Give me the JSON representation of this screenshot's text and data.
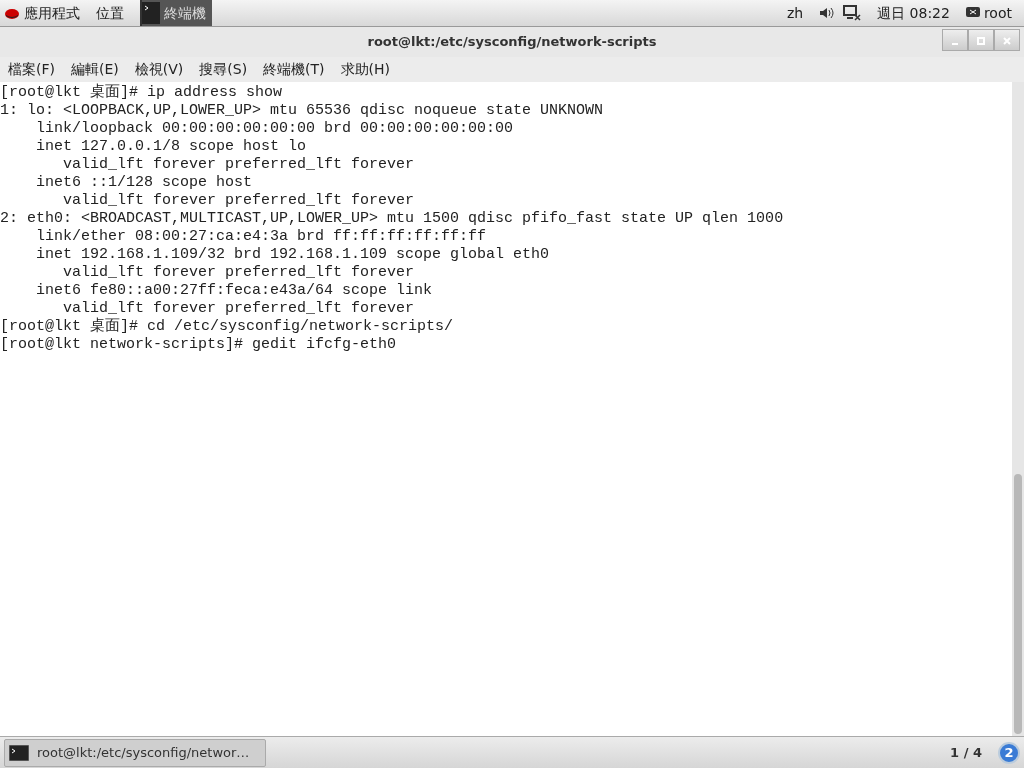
{
  "top_panel": {
    "applications": "應用程式",
    "places": "位置",
    "active_app": "終端機",
    "input_method": "zh",
    "clock": "週日 08:22",
    "user": "root"
  },
  "window": {
    "title": "root@lkt:/etc/sysconfig/network-scripts"
  },
  "menu": [
    "檔案(F)",
    "編輯(E)",
    "檢視(V)",
    "搜尋(S)",
    "終端機(T)",
    "求助(H)"
  ],
  "terminal_lines": [
    "[root@lkt 桌面]# ip address show",
    "1: lo: <LOOPBACK,UP,LOWER_UP> mtu 65536 qdisc noqueue state UNKNOWN",
    "    link/loopback 00:00:00:00:00:00 brd 00:00:00:00:00:00",
    "    inet 127.0.0.1/8 scope host lo",
    "       valid_lft forever preferred_lft forever",
    "    inet6 ::1/128 scope host",
    "       valid_lft forever preferred_lft forever",
    "2: eth0: <BROADCAST,MULTICAST,UP,LOWER_UP> mtu 1500 qdisc pfifo_fast state UP qlen 1000",
    "    link/ether 08:00:27:ca:e4:3a brd ff:ff:ff:ff:ff:ff",
    "    inet 192.168.1.109/32 brd 192.168.1.109 scope global eth0",
    "       valid_lft forever preferred_lft forever",
    "    inet6 fe80::a00:27ff:feca:e43a/64 scope link",
    "       valid_lft forever preferred_lft forever",
    "[root@lkt 桌面]# cd /etc/sysconfig/network-scripts/",
    "[root@lkt network-scripts]# gedit ifcfg-eth0"
  ],
  "taskbar": {
    "task": "root@lkt:/etc/sysconfig/networ…",
    "workspace": "1 / 4",
    "notifications": "2"
  }
}
